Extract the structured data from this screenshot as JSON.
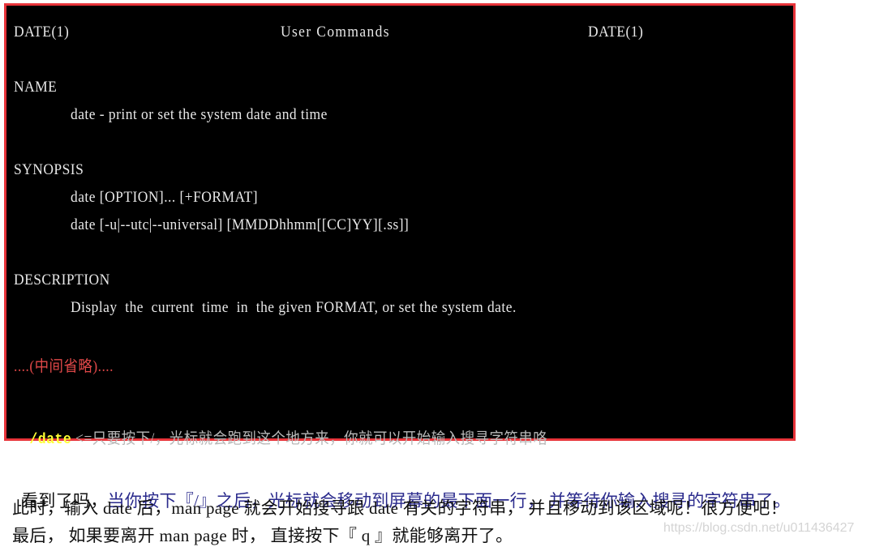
{
  "terminal": {
    "header_left": "DATE(1)",
    "header_center": "User Commands",
    "header_right": "DATE(1)",
    "sections": {
      "name_heading": "NAME",
      "name_text": "date - print or set the system date and time",
      "synopsis_heading": "SYNOPSIS",
      "synopsis_line1": "date [OPTION]... [+FORMAT]",
      "synopsis_line2": "date [-u|--utc|--universal] [MMDDhhmm[[CC]YY][.ss]]",
      "description_heading": "DESCRIPTION",
      "description_text": "Display  the  current  time  in  the given FORMAT, or set the system date."
    },
    "omitted_marker": "....(中间省略)....",
    "search_prompt": "/date",
    "search_note": " <=只要按下/，光标就会跑到这个地方来，你就可以开始输入搜寻字符串咯",
    "colors": {
      "border": "#e8343a",
      "background": "#000000",
      "text": "#e8e8e8",
      "omitted": "#e04848",
      "search_prompt": "#ffff33"
    }
  },
  "caption": {
    "line1_plain": "看到了吗，",
    "line1_blue": "当你按下『/』之后，光标就会移动到屏幕的最下面一行， 并等待你输入搜寻的字符串了。",
    "line2": "此时，输入 date 后，man page 就会开始搜寻跟 date 有关的字符串， 并且移动到该区域呢！很方便吧！",
    "line3": "最后， 如果要离开 man page 时， 直接按下『 q 』就能够离开了。"
  },
  "watermark": "https://blog.csdn.net/u011436427"
}
